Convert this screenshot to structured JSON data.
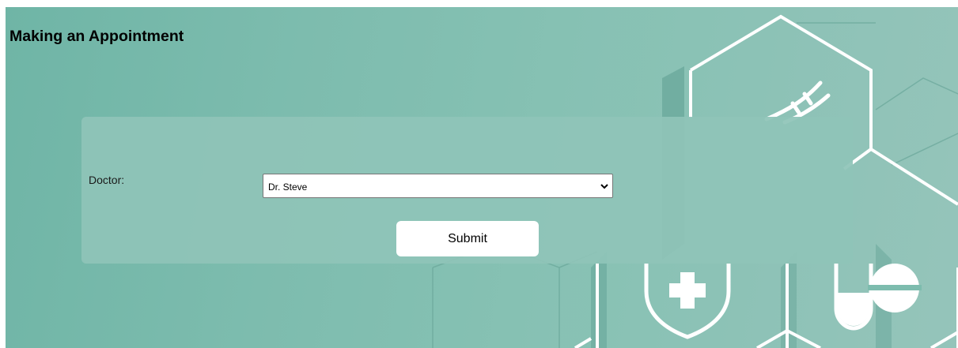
{
  "page": {
    "title": "Making an Appointment"
  },
  "form": {
    "doctor_label": "Doctor:",
    "doctor_selected": "Dr. Steve",
    "submit_label": "Submit"
  },
  "icons": [
    "chevron-down-icon",
    "dna-icon",
    "shield-cross-icon",
    "capsule-icon",
    "pill-icon"
  ],
  "colors": {
    "background": "#7dbcae",
    "card": "#8fc4b8",
    "hex_lines": "#ffffff"
  }
}
